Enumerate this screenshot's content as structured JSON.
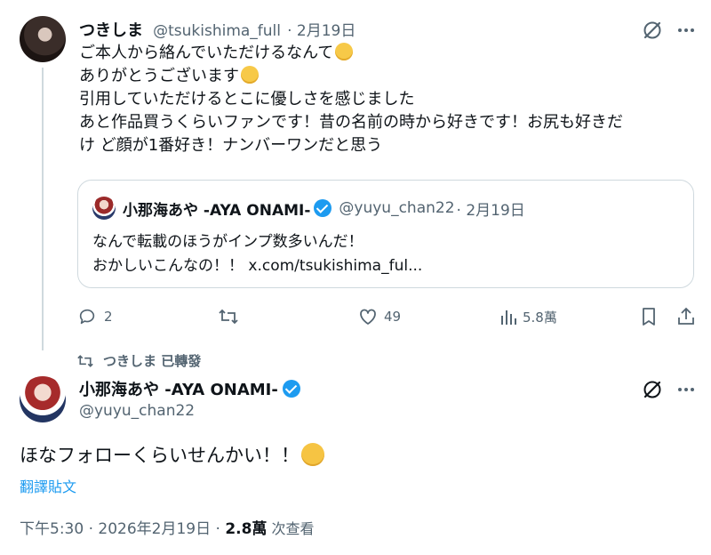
{
  "first_tweet": {
    "display_name": "つきしま",
    "handle": "@tsukishima_full",
    "date": "· 2月19日",
    "lines": [
      "ご本人から絡んでいただけるなんて",
      "ありがとうございます",
      "引用していただけるとこに優しさを感じました",
      "あと作品買うくらいファンです！昔の名前の時から好きです！お尻も好きだ",
      "け ど顔が1番好き！ナンバーワンだと思う"
    ],
    "quote": {
      "display_name": "小那海あや -AYA ONAMI-",
      "handle": "@yuyu_chan22",
      "date": "· 2月19日",
      "line1": "なんで転載のほうがインプ数多いんだ！",
      "line2": "おかしいこんなの！！ x.com/tsukishima_ful..."
    },
    "actions": {
      "replies": "2",
      "likes": "49",
      "views": "5.8萬"
    }
  },
  "repost_label": "つきしま 已轉發",
  "second_tweet": {
    "display_name": "小那海あや -AYA ONAMI-",
    "handle": "@yuyu_chan22",
    "text": "ほなフォローくらいせんかい！！",
    "translate_label": "翻譯貼文",
    "timestamp": "下午5:30 · 2026年2月19日 · ",
    "views_count": "2.8萬",
    "views_label": " 次查看"
  },
  "colors": {
    "accent_blue": "#1d9bf0",
    "muted_gray": "#536471",
    "text_dark": "#0f1419",
    "border": "#cfd9de"
  }
}
